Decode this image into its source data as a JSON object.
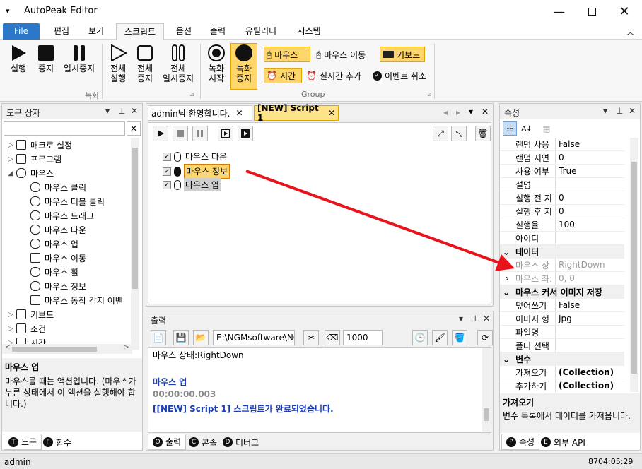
{
  "app": {
    "title": "AutoPeak Editor"
  },
  "ribbon_tabs": [
    "File",
    "편집",
    "보기",
    "스크립트",
    "옵션",
    "출력",
    "유틸리티",
    "시스템"
  ],
  "ribbon": {
    "play": "실행",
    "stop": "중지",
    "pause": "일시중지",
    "all_play": "전체\n실행",
    "all_stop": "전체\n중지",
    "all_pause": "전체\n일시중지",
    "rec_start": "녹화\n시작",
    "rec_stop": "녹화\n중지",
    "mouse": "마우스",
    "mouse_move": "마우스 이동",
    "keyboard": "키보드",
    "time": "시간",
    "realtime_add": "실시간 추가",
    "event_cancel": "이벤트 취소",
    "group_record": "녹화",
    "group_group": "Group"
  },
  "toolbox": {
    "title": "도구 상자",
    "items": [
      {
        "label": "매크로 설정",
        "icon": "globe-icon",
        "expand": "▷"
      },
      {
        "label": "프로그램",
        "icon": "monitor-icon",
        "expand": "▷"
      },
      {
        "label": "마우스",
        "icon": "mouse-icon",
        "expand": "◢"
      },
      {
        "label": "마우스 클릭",
        "icon": "mouse-click-icon",
        "expand": ""
      },
      {
        "label": "마우스 더블 클릭",
        "icon": "mouse-double-click-icon",
        "expand": ""
      },
      {
        "label": "마우스 드래그",
        "icon": "mouse-drag-icon",
        "expand": ""
      },
      {
        "label": "마우스 다운",
        "icon": "mouse-down-icon",
        "expand": ""
      },
      {
        "label": "마우스 업",
        "icon": "mouse-up-icon",
        "expand": ""
      },
      {
        "label": "마우스 이동",
        "icon": "move-icon",
        "expand": ""
      },
      {
        "label": "마우스 휠",
        "icon": "mouse-wheel-icon",
        "expand": ""
      },
      {
        "label": "마우스 정보",
        "icon": "mouse-info-icon",
        "expand": ""
      },
      {
        "label": "마우스 동작 감지 이벤",
        "icon": "lightning-icon",
        "expand": ""
      },
      {
        "label": "키보드",
        "icon": "keyboard-icon",
        "expand": "▷"
      },
      {
        "label": "조건",
        "icon": "branch-icon",
        "expand": "▷"
      },
      {
        "label": "시간",
        "icon": "calendar-icon",
        "expand": "▷"
      }
    ],
    "desc_title": "마우스 업",
    "desc_text": "마우스를 때는 액션입니다. (마우스가 누른 상태에서 이 액션을 실행해야 합니다.)",
    "tab_tools": "도구",
    "tab_funcs": "함수"
  },
  "editor": {
    "tabs": [
      "admin님 환영합니다.",
      "[NEW] Script 1"
    ],
    "lines": [
      "마우스 다운",
      "마우스 정보",
      "마우스 업"
    ]
  },
  "output": {
    "title": "출력",
    "path": "E:\\NGMsoftware\\NG",
    "count": "1000",
    "lines": [
      {
        "text": "마우스 상태:RightDown",
        "color": "#000",
        "bold": false
      },
      {
        "text": "",
        "color": "#000",
        "bold": false
      },
      {
        "text": "마우스 업",
        "color": "#1c3fb8",
        "bold": true
      },
      {
        "text": "00:00:00.003",
        "color": "#888",
        "bold": true
      },
      {
        "text": "[[NEW] Script 1] 스크립트가 완료되었습니다.",
        "color": "#1c3fb8",
        "bold": true
      }
    ],
    "tab_output": "출력",
    "tab_console": "콘솔",
    "tab_debug": "디버그"
  },
  "properties": {
    "title": "속성",
    "rows": [
      {
        "type": "row",
        "k": "랜덤 사용",
        "v": "False"
      },
      {
        "type": "row",
        "k": "랜덤 지연",
        "v": "0"
      },
      {
        "type": "row",
        "k": "사용 여부",
        "v": "True"
      },
      {
        "type": "row",
        "k": "설명",
        "v": ""
      },
      {
        "type": "row",
        "k": "실행 전 지",
        "v": "0"
      },
      {
        "type": "row",
        "k": "실행 후 지",
        "v": "0"
      },
      {
        "type": "row",
        "k": "실행율",
        "v": "100"
      },
      {
        "type": "row",
        "k": "아이디",
        "v": ""
      },
      {
        "type": "cat",
        "k": "데이터"
      },
      {
        "type": "row",
        "k": "마우스 상",
        "v": "RightDown",
        "gray": true
      },
      {
        "type": "row",
        "k": "마우스 좌:",
        "v": "0, 0",
        "gray": true,
        "expand": true
      },
      {
        "type": "cat",
        "k": "마우스 커서 이미지 저장"
      },
      {
        "type": "row",
        "k": "덮어쓰기",
        "v": "False"
      },
      {
        "type": "row",
        "k": "이미지 형",
        "v": "Jpg"
      },
      {
        "type": "row",
        "k": "파일명",
        "v": ""
      },
      {
        "type": "row",
        "k": "폴더 선택",
        "v": ""
      },
      {
        "type": "cat",
        "k": "변수"
      },
      {
        "type": "row",
        "k": "가져오기",
        "v": "(Collection)",
        "bold": true
      },
      {
        "type": "row",
        "k": "추가하기",
        "v": "(Collection)",
        "bold": true
      }
    ],
    "desc_title": "가져오기",
    "desc_text": "변수 목록에서 데이터를 가져옵니다.",
    "tab_props": "속성",
    "tab_api": "외부 API"
  },
  "status": {
    "user": "admin",
    "time": "8704:05:29"
  }
}
